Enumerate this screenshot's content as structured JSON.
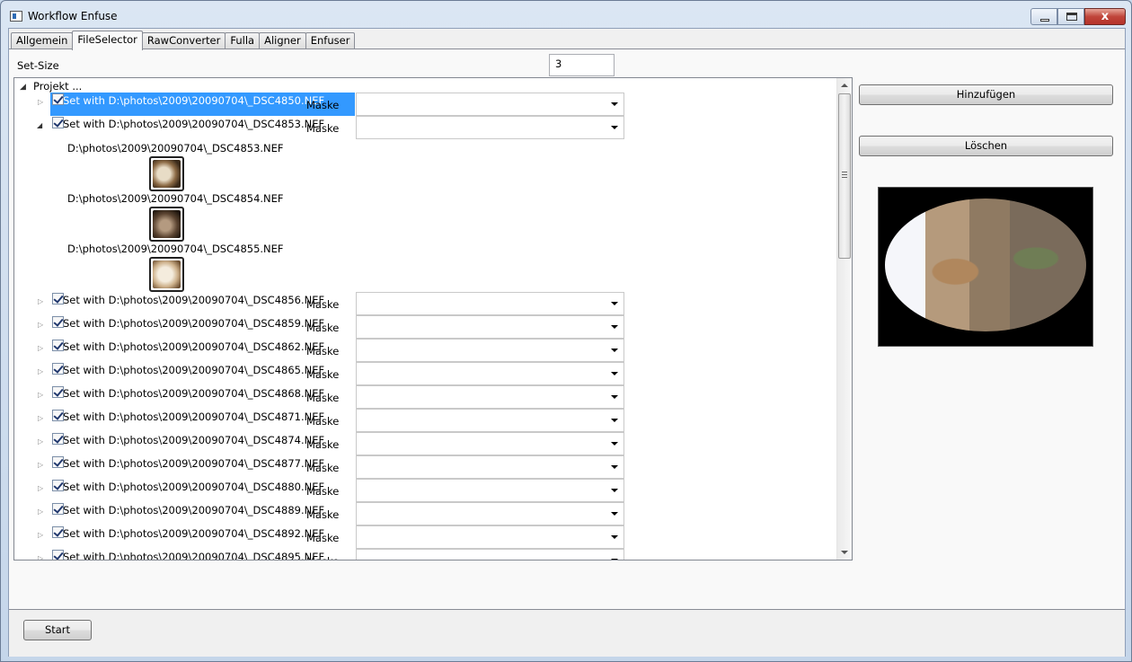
{
  "window": {
    "title": "Workflow Enfuse",
    "close_glyph": "x"
  },
  "tabs": [
    {
      "label": "Allgemein"
    },
    {
      "label": "FileSelector",
      "active": true
    },
    {
      "label": "RawConverter"
    },
    {
      "label": "Fulla"
    },
    {
      "label": "Aligner"
    },
    {
      "label": "Enfuser"
    }
  ],
  "set_size": {
    "label": "Set-Size",
    "value": "3"
  },
  "tree": {
    "root": "Projekt ...",
    "mask_label": "Maske",
    "sets": [
      {
        "label": "Set with D:\\photos\\2009\\20090704\\_DSC4850.NEF",
        "checked": true,
        "selected": true,
        "expanded": false
      },
      {
        "label": "Set with D:\\photos\\2009\\20090704\\_DSC4853.NEF",
        "checked": true,
        "selected": false,
        "expanded": true,
        "files": [
          "D:\\photos\\2009\\20090704\\_DSC4853.NEF",
          "D:\\photos\\2009\\20090704\\_DSC4854.NEF",
          "D:\\photos\\2009\\20090704\\_DSC4855.NEF"
        ]
      },
      {
        "label": "Set with D:\\photos\\2009\\20090704\\_DSC4856.NEF",
        "checked": true
      },
      {
        "label": "Set with D:\\photos\\2009\\20090704\\_DSC4859.NEF",
        "checked": true
      },
      {
        "label": "Set with D:\\photos\\2009\\20090704\\_DSC4862.NEF",
        "checked": true
      },
      {
        "label": "Set with D:\\photos\\2009\\20090704\\_DSC4865.NEF",
        "checked": true
      },
      {
        "label": "Set with D:\\photos\\2009\\20090704\\_DSC4868.NEF",
        "checked": true
      },
      {
        "label": "Set with D:\\photos\\2009\\20090704\\_DSC4871.NEF",
        "checked": true
      },
      {
        "label": "Set with D:\\photos\\2009\\20090704\\_DSC4874.NEF",
        "checked": true
      },
      {
        "label": "Set with D:\\photos\\2009\\20090704\\_DSC4877.NEF",
        "checked": true
      },
      {
        "label": "Set with D:\\photos\\2009\\20090704\\_DSC4880.NEF",
        "checked": true
      },
      {
        "label": "Set with D:\\photos\\2009\\20090704\\_DSC4889.NEF",
        "checked": true
      },
      {
        "label": "Set with D:\\photos\\2009\\20090704\\_DSC4892.NEF",
        "checked": true
      },
      {
        "label": "Set with D:\\photos\\2009\\20090704\\_DSC4895.NEF",
        "checked": true
      }
    ]
  },
  "actions": {
    "add_label": "Hinzufügen",
    "delete_label": "Löschen",
    "start_label": "Start"
  },
  "colors": {
    "selection": "#3399ff",
    "titlebar": "#dbe6f3",
    "panel": "#f9f9f9"
  }
}
